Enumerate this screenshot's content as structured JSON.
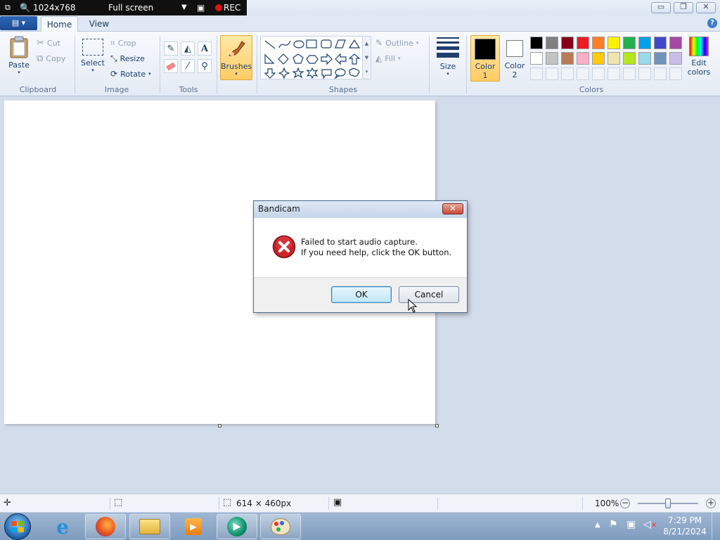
{
  "bandicam": {
    "resolution": "1024x768",
    "mode": "Full screen",
    "rec": "REC"
  },
  "window": {
    "minimize": "▭",
    "restore": "❐",
    "close": "✕"
  },
  "ribbon": {
    "tabs": {
      "home": "Home",
      "view": "View"
    },
    "clipboard": {
      "paste": "Paste",
      "cut": "Cut",
      "copy": "Copy",
      "group": "Clipboard"
    },
    "image": {
      "select": "Select",
      "crop": "Crop",
      "resize": "Resize",
      "rotate": "Rotate",
      "group": "Image"
    },
    "tools": {
      "group": "Tools",
      "text_tool": "A"
    },
    "brushes": {
      "label": "Brushes"
    },
    "shapes": {
      "group": "Shapes",
      "outline": "Outline",
      "fill": "Fill"
    },
    "size": {
      "label": "Size"
    },
    "colors": {
      "color1": "Color",
      "color1_num": "1",
      "color2": "Color",
      "color2_num": "2",
      "group": "Colors",
      "edit": "Edit",
      "edit2": "colors",
      "color1_value": "#000000",
      "color2_value": "#ffffff",
      "row1": [
        "#000000",
        "#7f7f7f",
        "#880015",
        "#ed1c24",
        "#ff7f27",
        "#fff200",
        "#22b14c",
        "#00a2e8",
        "#3f48cc",
        "#a349a4"
      ],
      "row2": [
        "#ffffff",
        "#c3c3c3",
        "#b97a57",
        "#ffaec9",
        "#ffc90e",
        "#efe4b0",
        "#b5e61d",
        "#99d9ea",
        "#7092be",
        "#c8bfe7"
      ]
    }
  },
  "dialog": {
    "title": "Bandicam",
    "close": "✕",
    "line1": "Failed to start audio capture.",
    "line2": "If you need help, click the OK button.",
    "ok": "OK",
    "cancel": "Cancel"
  },
  "status": {
    "dimensions": "614 × 460px",
    "zoom": "100%",
    "zoom_fraction": 0.5
  },
  "clock": {
    "time": "7:29 PM",
    "date": "8/21/2024"
  }
}
